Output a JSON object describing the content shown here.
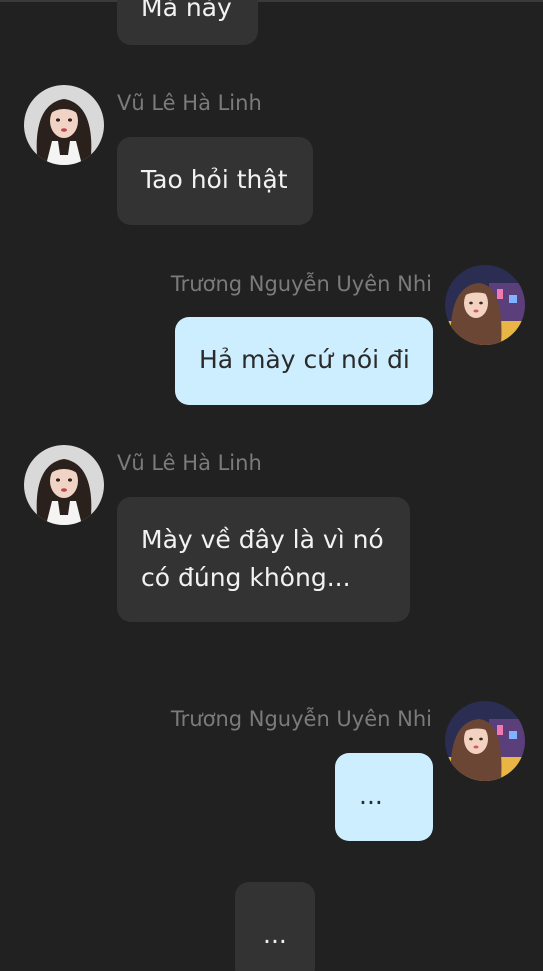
{
  "chat": {
    "messages": [
      {
        "side": "left",
        "sender": "",
        "text": "Mà này",
        "avatar": "girl-dark-hair-avatar"
      },
      {
        "side": "left",
        "sender": "Vũ Lê Hà Linh",
        "text": "Tao hỏi thật",
        "avatar": "girl-dark-hair-avatar"
      },
      {
        "side": "right",
        "sender": "Trương Nguyễn Uyên Nhi",
        "text": "Hả mày cứ nói đi",
        "avatar": "girl-city-night-avatar"
      },
      {
        "side": "left",
        "sender": "Vũ Lê Hà Linh",
        "text": "Mày về đây là vì nó\ncó đúng không...",
        "avatar": "girl-dark-hair-avatar"
      },
      {
        "side": "right",
        "sender": "Trương Nguyễn Uyên Nhi",
        "text": "...",
        "avatar": "girl-city-night-avatar"
      },
      {
        "side": "left",
        "sender": "",
        "text": "...",
        "avatar": ""
      }
    ]
  },
  "colors": {
    "background": "#212121",
    "left_bubble": "#333333",
    "right_bubble": "#cdeefe",
    "sender_name": "#7b7b7b"
  }
}
